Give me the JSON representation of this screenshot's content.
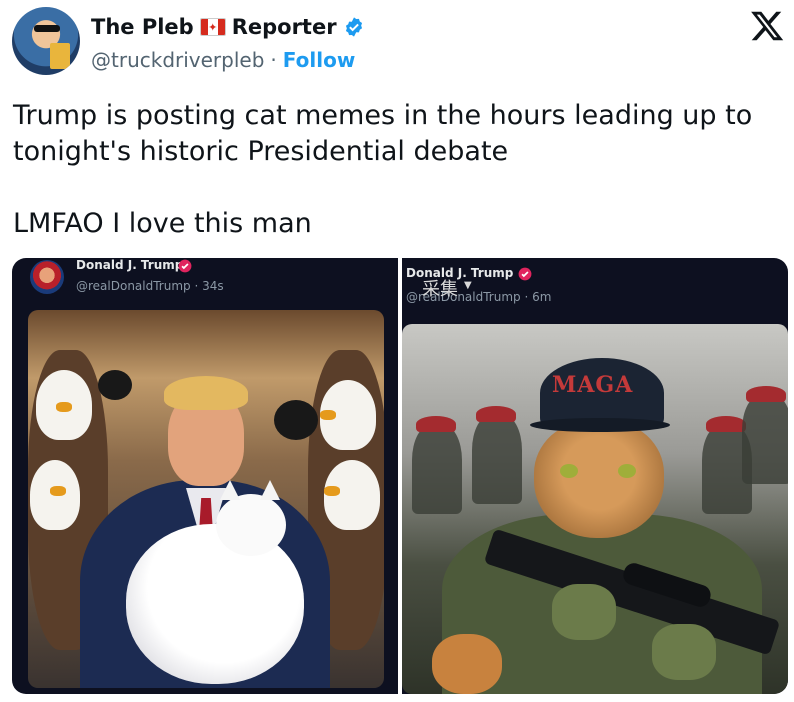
{
  "author": {
    "display_name": "The Pleb",
    "badge_label": "Reporter",
    "flag_icon": "canada-flag-icon",
    "verified_icon": "verified-badge-icon",
    "verified_color": "#1d9bf0",
    "handle": "@truckdriverpleb",
    "separator": "·",
    "follow_label": "Follow"
  },
  "tweet": {
    "text": "Trump is posting cat memes in the hours leading up to\ntonight's historic Presidential debate\n\nLMFAO I love this man"
  },
  "media": {
    "left": {
      "name": "Donald J. Trump",
      "handle_time": "@realDonaldTrump · 34s"
    },
    "right": {
      "name": "Donald J. Trump",
      "handle_time": "@realDonaldTrump · 6m",
      "watermark": "采集",
      "cap_text": "MAGA"
    }
  },
  "colors": {
    "text": "#0f1419",
    "secondary": "#536471",
    "link": "#1d9bf0",
    "media_bg": "#0d1020"
  }
}
